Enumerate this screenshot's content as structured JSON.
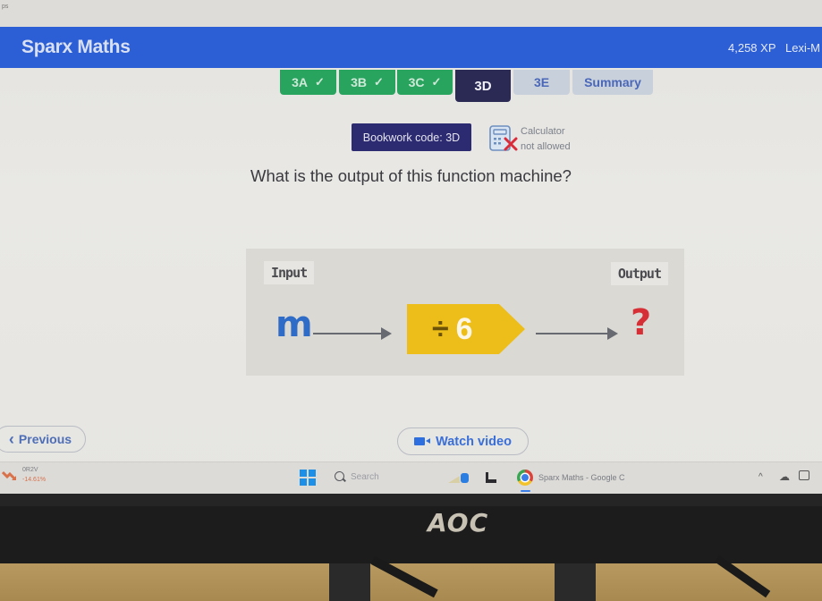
{
  "browser": {
    "tab_fragment": "ps"
  },
  "header": {
    "brand": "Sparx Maths",
    "xp": "4,258 XP",
    "user": "Lexi-M"
  },
  "tabs": [
    {
      "label": "3A",
      "state": "complete",
      "check": "✓"
    },
    {
      "label": "3B",
      "state": "complete",
      "check": "✓"
    },
    {
      "label": "3C",
      "state": "complete",
      "check": "✓"
    },
    {
      "label": "3D",
      "state": "active"
    },
    {
      "label": "3E",
      "state": "incomplete"
    },
    {
      "label": "Summary",
      "state": "incomplete"
    }
  ],
  "bookwork": {
    "label": "Bookwork code: 3D"
  },
  "calculator": {
    "line1": "Calculator",
    "line2": "not allowed",
    "icon": "calculator-not-allowed-icon"
  },
  "question": {
    "text": "What is the output of this function machine?"
  },
  "function_machine": {
    "input_label": "Input",
    "output_label": "Output",
    "input_value": "m",
    "operation_symbol": "÷",
    "operation_value": "6",
    "output_value": "?"
  },
  "navigation": {
    "previous_label": "Previous",
    "previous_icon": "‹",
    "watch_video_label": "Watch video"
  },
  "taskbar": {
    "stock_name": "0R2V",
    "stock_change": "-14.61%",
    "search_placeholder": "Search",
    "active_window": "Sparx Maths - Google C",
    "tray_chevron": "^"
  },
  "monitor": {
    "brand": "AOC"
  },
  "colors": {
    "header_blue": "#2c5ed6",
    "tab_complete": "#28a45f",
    "tab_active": "#2a2a55",
    "tab_incomplete": "#c8d0dc",
    "bookwork_bg": "#2c2a70",
    "operation_yellow": "#edbd1a",
    "input_blue": "#2f6cc7",
    "output_red": "#d63036"
  }
}
